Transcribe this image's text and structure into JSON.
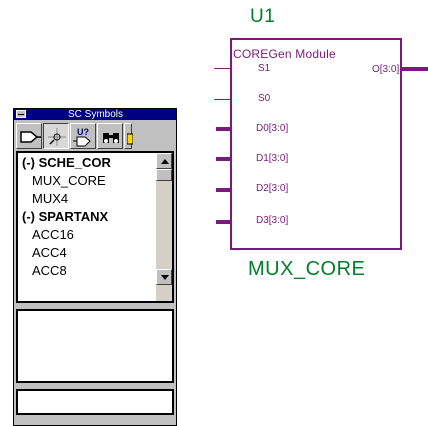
{
  "schematic": {
    "ref_designator": "U1",
    "symbol_name": "MUX_CORE",
    "block_title": "COREGen Module",
    "output_pin": "O[3:0]",
    "input_pins": [
      "S1",
      "S0",
      "D0[3:0]",
      "D1[3:0]",
      "D2[3:0]",
      "D3[3:0]"
    ],
    "colors": {
      "wire": "#7a1a7a",
      "label": "#00802a"
    }
  },
  "palette": {
    "title": "SC Symbols",
    "toolbar_icons": [
      "add-symbol-icon",
      "probe-icon",
      "query-symbol-icon",
      "binoculars-icon",
      "folder-icon"
    ],
    "query_icon_text": "U?",
    "list_items": [
      "(-) SCHE_COR",
      "MUX_CORE",
      "MUX4",
      "(-) SPARTANX",
      "ACC16",
      "ACC4",
      "ACC8"
    ],
    "colors": {
      "title_bar": "#000080",
      "face": "#c0c0c0"
    }
  }
}
